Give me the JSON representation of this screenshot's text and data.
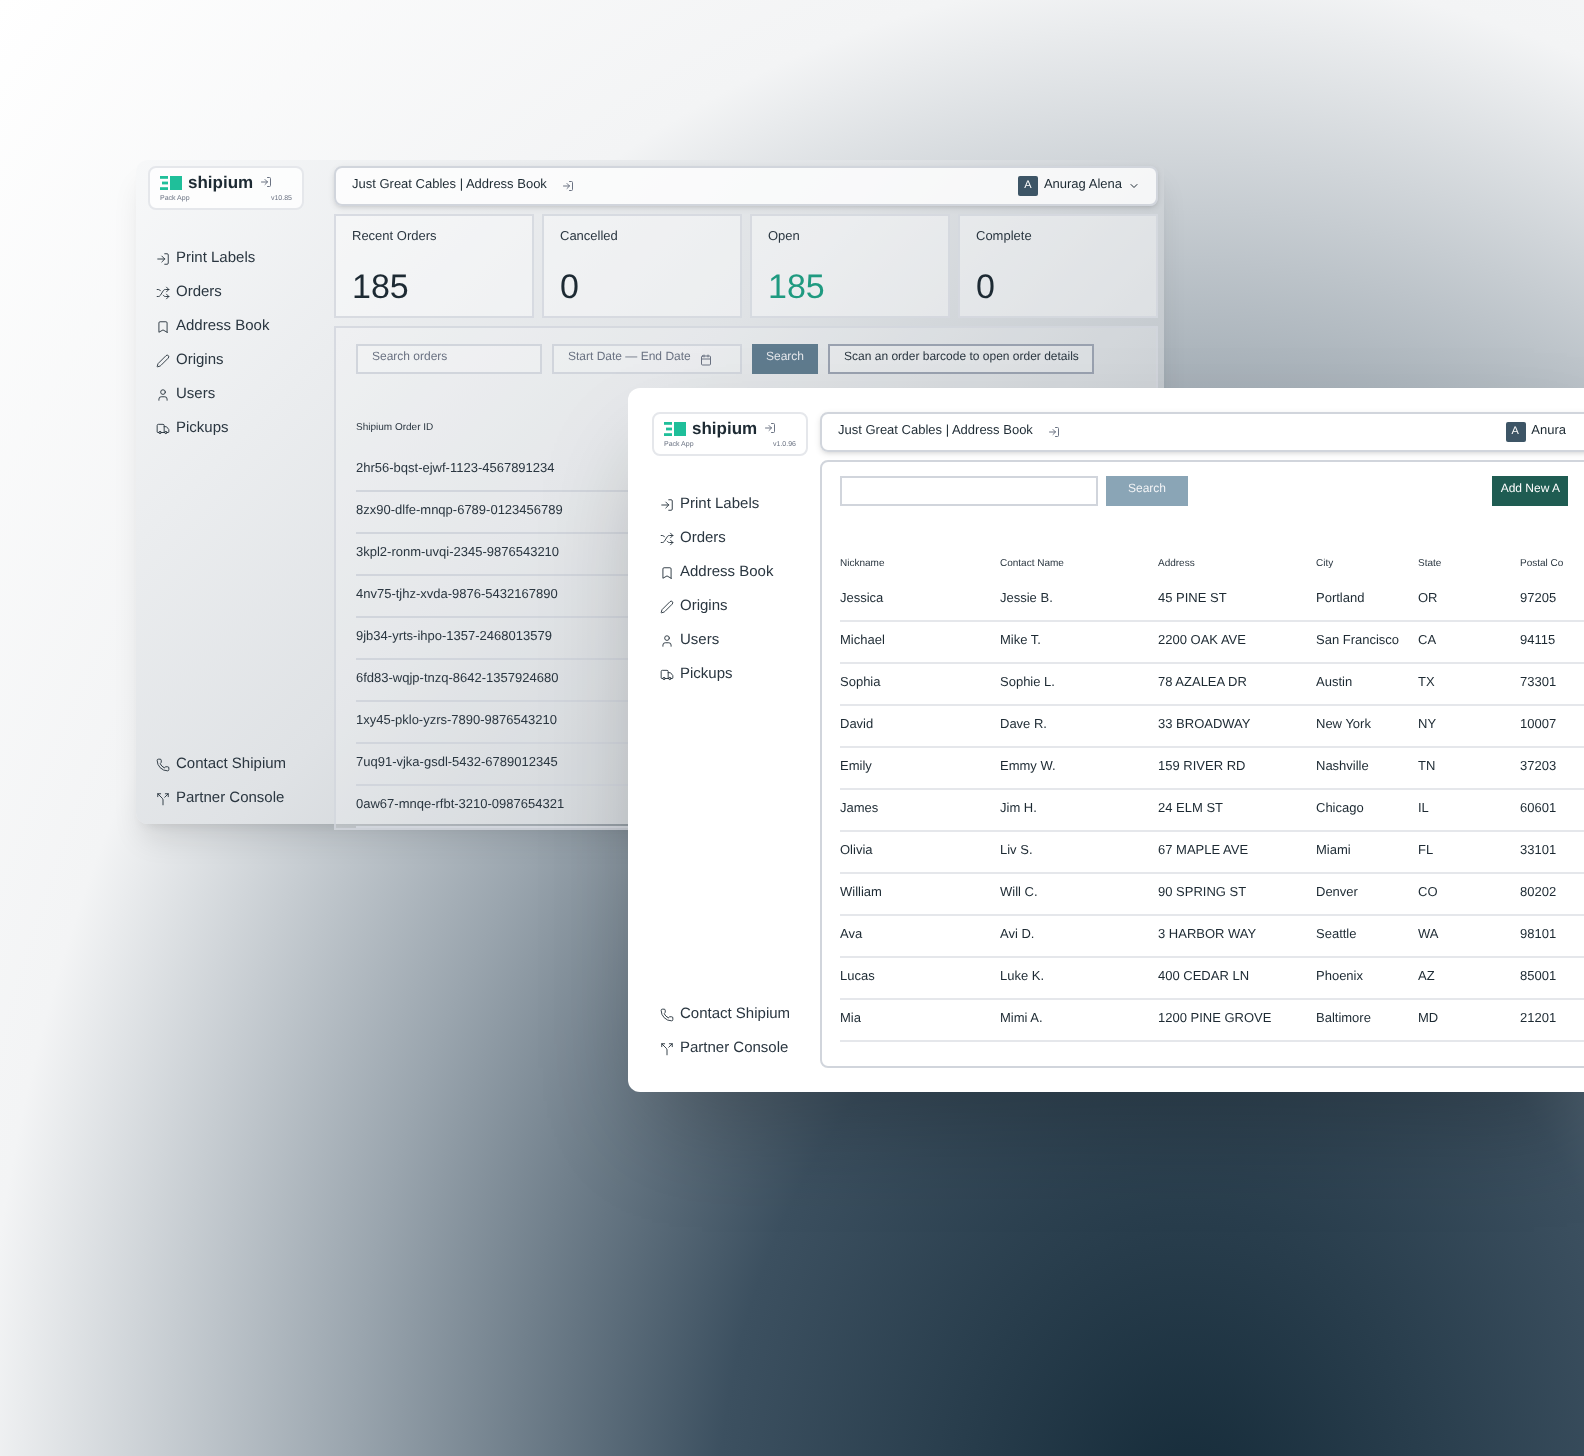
{
  "back_window": {
    "app": {
      "brand": "shipium",
      "subtitle": "Pack App",
      "version": "v10.85"
    },
    "nav": [
      {
        "label": "Print Labels"
      },
      {
        "label": "Orders"
      },
      {
        "label": "Address Book"
      },
      {
        "label": "Origins"
      },
      {
        "label": "Users"
      },
      {
        "label": "Pickups"
      }
    ],
    "footer_nav": [
      {
        "label": "Contact Shipium"
      },
      {
        "label": "Partner Console"
      }
    ],
    "header": {
      "title": "Just Great Cables | Address Book",
      "user_initial": "A",
      "user_name": "Anurag Alena",
      "menu_caret": true
    },
    "stats": [
      {
        "label": "Recent Orders",
        "value": "185",
        "highlighted": false
      },
      {
        "label": "Cancelled",
        "value": "0",
        "highlighted": false
      },
      {
        "label": "Open",
        "value": "185",
        "highlighted": true
      },
      {
        "label": "Complete",
        "value": "0",
        "highlighted": false
      }
    ],
    "filters": {
      "search_placeholder": "Search orders",
      "date_placeholder": "Start Date — End Date",
      "search_button": "Search",
      "scan_button": "Scan an order barcode to open order details"
    },
    "table": {
      "columns": [
        "Shipium Order ID"
      ],
      "rows": [
        "2hr56-bqst-ejwf-1123-4567891234",
        "8zx90-dlfe-mnqp-6789-0123456789",
        "3kpl2-ronm-uvqi-2345-9876543210",
        "4nv75-tjhz-xvda-9876-5432167890",
        "9jb34-yrts-ihpo-1357-2468013579",
        "6fd83-wqjp-tnzq-8642-1357924680",
        "1xy45-pklo-yzrs-7890-9876543210",
        "7uq91-vjka-gsdl-5432-6789012345",
        "0aw67-mnqe-rfbt-3210-0987654321"
      ]
    }
  },
  "front_window": {
    "app": {
      "brand": "shipium",
      "subtitle": "Pack App",
      "version": "v1.0.96"
    },
    "nav": [
      {
        "label": "Print Labels"
      },
      {
        "label": "Orders"
      },
      {
        "label": "Address Book"
      },
      {
        "label": "Origins"
      },
      {
        "label": "Users"
      },
      {
        "label": "Pickups"
      }
    ],
    "footer_nav": [
      {
        "label": "Contact Shipium"
      },
      {
        "label": "Partner Console"
      }
    ],
    "header": {
      "title": "Just Great Cables | Address Book",
      "user_initial": "A",
      "user_name": "Anura",
      "menu_caret": false
    },
    "search_button": "Search",
    "add_button": "Add New A",
    "table": {
      "columns": [
        "Nickname",
        "Contact Name",
        "Address",
        "City",
        "State",
        "Postal Co"
      ],
      "rows": [
        [
          "Jessica",
          "Jessie B.",
          "45 PINE ST",
          "Portland",
          "OR",
          "97205"
        ],
        [
          "Michael",
          "Mike T.",
          "2200 OAK AVE",
          "San Francisco",
          "CA",
          "94115"
        ],
        [
          "Sophia",
          "Sophie L.",
          "78 AZALEA DR",
          "Austin",
          "TX",
          "73301"
        ],
        [
          "David",
          "Dave R.",
          "33 BROADWAY",
          "New York",
          "NY",
          "10007"
        ],
        [
          "Emily",
          "Emmy W.",
          "159 RIVER RD",
          "Nashville",
          "TN",
          "37203"
        ],
        [
          "James",
          "Jim H.",
          "24 ELM ST",
          "Chicago",
          "IL",
          "60601"
        ],
        [
          "Olivia",
          "Liv S.",
          "67 MAPLE AVE",
          "Miami",
          "FL",
          "33101"
        ],
        [
          "William",
          "Will C.",
          "90 SPRING ST",
          "Denver",
          "CO",
          "80202"
        ],
        [
          "Ava",
          "Avi D.",
          "3 HARBOR WAY",
          "Seattle",
          "WA",
          "98101"
        ],
        [
          "Lucas",
          "Luke K.",
          "400 CEDAR LN",
          "Phoenix",
          "AZ",
          "85001"
        ],
        [
          "Mia",
          "Mimi A.",
          "1200 PINE GROVE",
          "Baltimore",
          "MD",
          "21201"
        ]
      ]
    }
  }
}
